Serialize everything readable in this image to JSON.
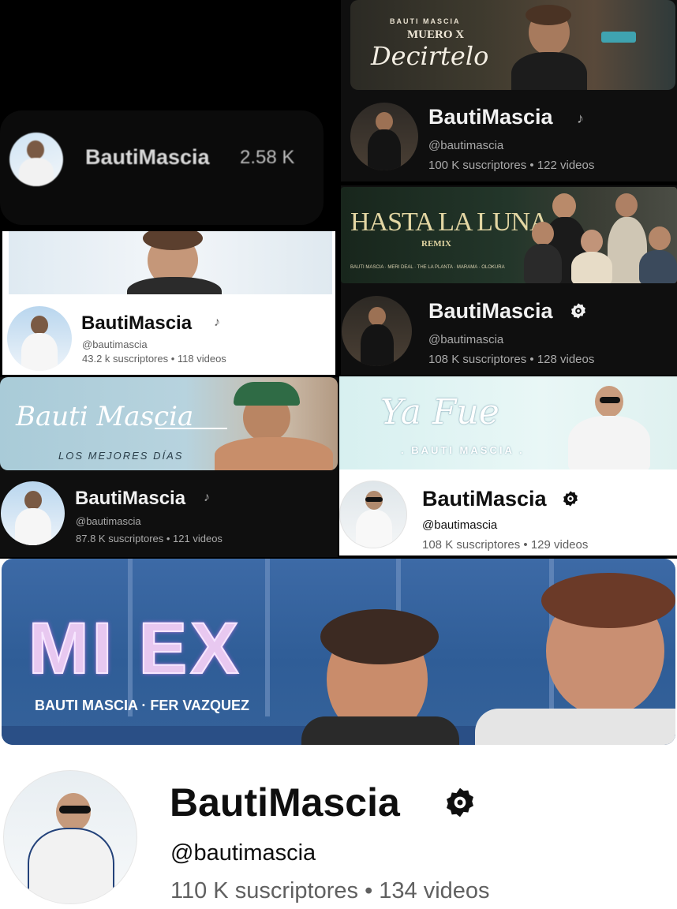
{
  "compact_bar": {
    "channel_name": "BautiMascia",
    "subscriber_count": "2.58 K"
  },
  "panel_muero": {
    "banner": {
      "artist_line": "BAUTI MASCIA",
      "title_line1": "MUERO X",
      "title_line2": "Decirtelo"
    },
    "channel_name": "BautiMascia",
    "badge_icon": "music-note-icon",
    "handle": "@bautimascia",
    "stats": "100 K suscriptores • 122 videos"
  },
  "panel_white_1": {
    "channel_name": "BautiMascia",
    "badge_icon": "music-note-icon",
    "handle": "@bautimascia",
    "stats": "43.2 k suscriptores • 118 videos"
  },
  "panel_hasta": {
    "banner": {
      "title": "HASTA LA LUNA",
      "subtitle": "REMIX",
      "credits": "BAUTI MASCIA · MERI DEAL · THE LA PLANTA · MARAMA · OLOKURA"
    },
    "channel_name": "BautiMascia",
    "badge_icon": "verified-artist-icon",
    "handle": "@bautimascia",
    "stats": "108 K suscriptores • 128 videos"
  },
  "panel_mejores": {
    "banner": {
      "script_title": "Bauti Mascia",
      "subtitle": "LOS MEJORES DÍAS"
    },
    "channel_name": "BautiMascia",
    "badge_icon": "music-note-icon",
    "handle": "@bautimascia",
    "stats": "87.8 K suscriptores • 121 videos"
  },
  "panel_yafue": {
    "banner": {
      "script_title": "Ya Fue",
      "subtitle": ". BAUTI MASCIA ."
    },
    "channel_name": "BautiMascia",
    "badge_icon": "verified-artist-icon",
    "handle": "@bautimascia",
    "stats": "108 K suscriptores • 129 videos"
  },
  "panel_miex": {
    "banner": {
      "title": "MI EX",
      "credits": "BAUTI MASCIA · FER VAZQUEZ"
    },
    "channel_name": "BautiMascia",
    "badge_icon": "verified-artist-icon",
    "handle": "@bautimascia",
    "stats": "110 K suscriptores • 134 videos"
  },
  "colors": {
    "dark_bg": "#0f0f0f",
    "light_bg": "#ffffff",
    "muted_dark": "#aaaaaa",
    "muted_light": "#606060"
  }
}
